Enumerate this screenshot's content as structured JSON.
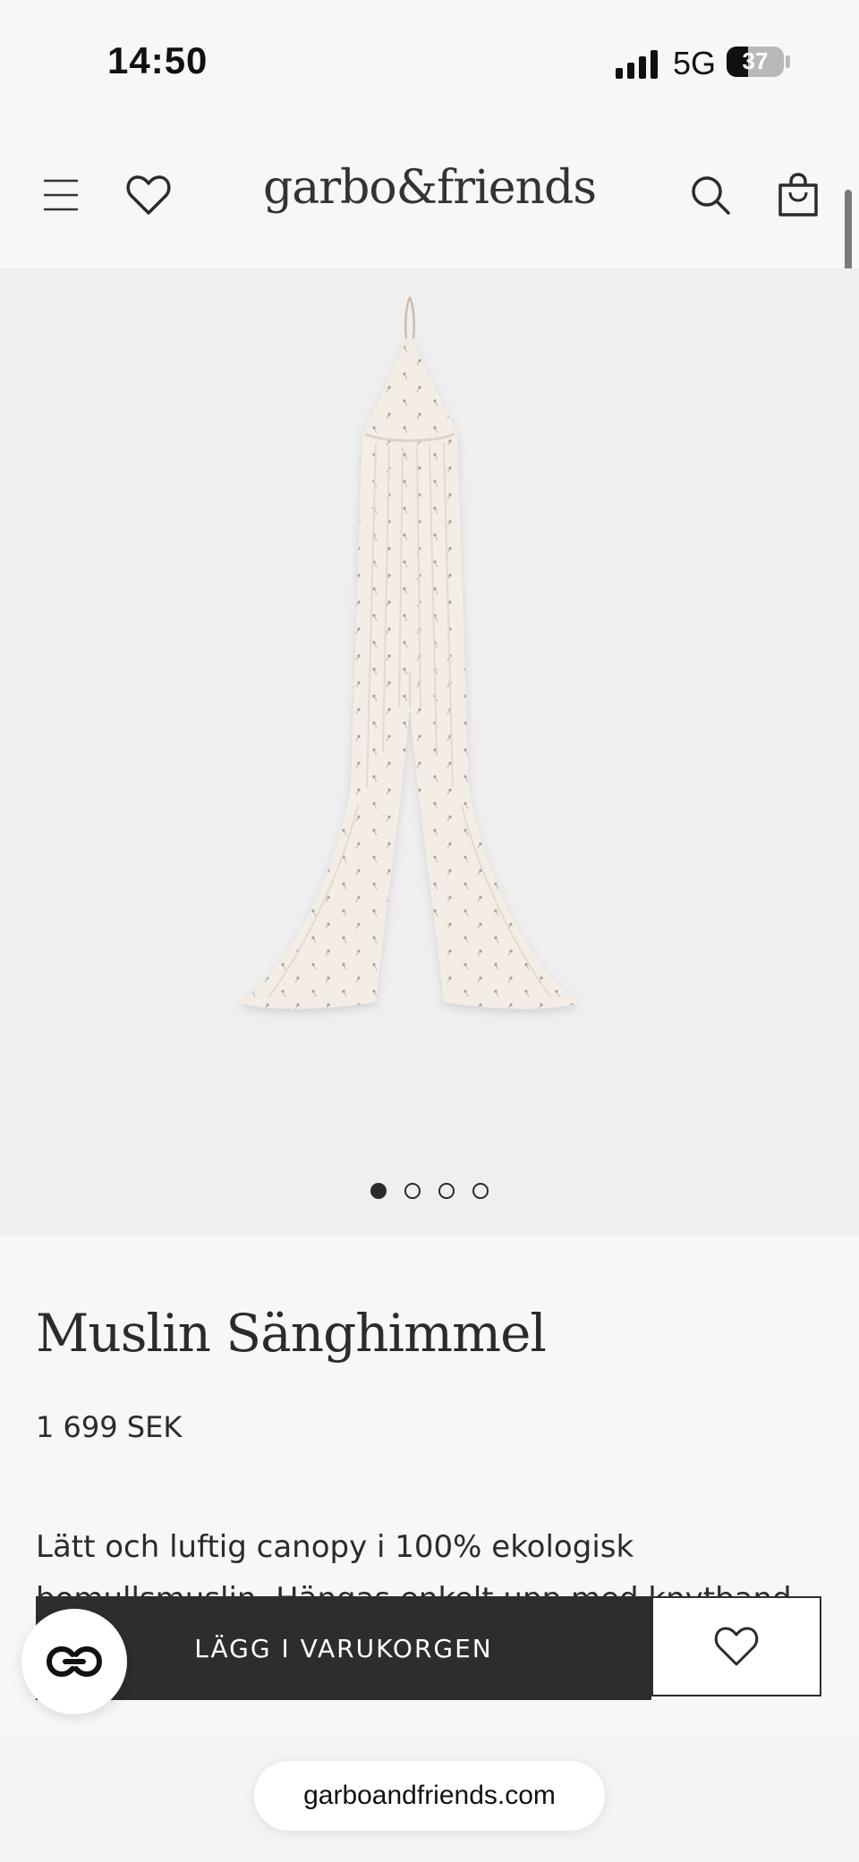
{
  "status_bar": {
    "time": "14:50",
    "network": "5G",
    "battery": "37",
    "battery_level": 0.37
  },
  "header": {
    "logo": "garbo&friends",
    "icons": [
      "menu-icon",
      "heart-icon",
      "search-icon",
      "shopping-bag-icon"
    ]
  },
  "gallery": {
    "image": "muslin-canopy-product-image",
    "slide_count": 4,
    "active_slide": 1
  },
  "product": {
    "title": "Muslin Sänghimmel",
    "price": "1 699 SEK",
    "description_line1": "Lätt och luftig canopy i 100% ekologisk",
    "description_line2": "bomullsmuslin. Hängas enkelt upp med knytband"
  },
  "buy_bar": {
    "add_to_cart_label": "LÄGG I VARUKORGEN"
  },
  "browser": {
    "url": "garboandfriends.com"
  },
  "colors": {
    "page_bg": "#f7f7f5",
    "gallery_bg": "#efefef",
    "dark_button": "#2d2d2d",
    "canopy_fabric": "#f4ede6"
  }
}
